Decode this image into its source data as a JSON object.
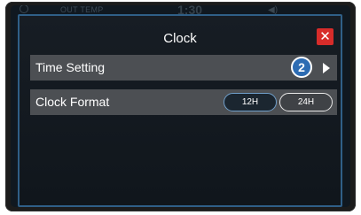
{
  "statusbar": {
    "temp_label": "OUT TEMP",
    "time": "1:30",
    "volume_icon": "speaker-icon"
  },
  "dialog": {
    "title": "Clock",
    "close_icon": "close-icon"
  },
  "rows": {
    "time_setting": {
      "label": "Time Setting",
      "badge": "2",
      "chevron_icon": "chevron-right-icon"
    },
    "clock_format": {
      "label": "Clock Format",
      "options": [
        "12H",
        "24H"
      ],
      "selected": "12H"
    }
  },
  "colors": {
    "dialog_border": "#2f5f87",
    "row_background": "#4c4f53",
    "close_button": "#d72c2a",
    "badge": "#2d6cb3",
    "selected_outline": "#6f9ec9"
  }
}
